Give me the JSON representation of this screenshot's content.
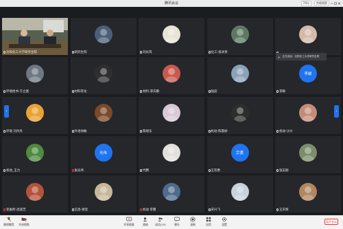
{
  "window": {
    "title": "腾讯会议",
    "count_badge": "29分",
    "view_button": "宫格视图"
  },
  "tiles": [
    {
      "label": "沈阳化工大学研究生院",
      "mic": "on",
      "kind": "video"
    },
    {
      "label": "研究生院",
      "mic": "on",
      "kind": "avatar",
      "avatar_color": "#4b5f78"
    },
    {
      "label": "刘长风",
      "mic": "on",
      "kind": "avatar",
      "avatar_color": "#e7e3d6"
    },
    {
      "label": "化工-张冰贵",
      "mic": "on",
      "kind": "avatar",
      "avatar_color": "#5c7a62"
    },
    {
      "label": "",
      "mic": "on",
      "kind": "avatar",
      "avatar_color": "#d3b9a8"
    },
    {
      "label": "环境给书-于立富",
      "mic": "on",
      "kind": "avatar",
      "avatar_color": "#6d7882"
    },
    {
      "label": "材料李龙",
      "mic": "on",
      "kind": "avatar",
      "avatar_color": "#2e2e2e"
    },
    {
      "label": "材料-李庆鹏",
      "mic": "on",
      "kind": "avatar",
      "avatar_color": "#c9594e"
    },
    {
      "label": "陆蕊",
      "mic": "on",
      "kind": "avatar",
      "avatar_color": "#8aa2b8"
    },
    {
      "label": "李颖",
      "mic": "on",
      "kind": "text",
      "avatar_text": "李颖"
    },
    {
      "label": "环境 刘丹丹",
      "mic": "on",
      "kind": "avatar",
      "avatar_color": "#e9a232"
    },
    {
      "label": "外语徐敏",
      "mic": "on",
      "kind": "avatar",
      "avatar_color": "#7a4a2a"
    },
    {
      "label": "陈晓东",
      "mic": "on",
      "kind": "avatar",
      "avatar_color": "#d8c8d8"
    },
    {
      "label": "机动-陈雷娇",
      "mic": "on",
      "kind": "avatar",
      "avatar_color": "#2d2d2d"
    },
    {
      "label": "机动-沙沙",
      "mic": "on",
      "kind": "avatar",
      "avatar_color": "#c48c78"
    },
    {
      "label": "机动_王力",
      "mic": "on",
      "kind": "avatar",
      "avatar_color": "#4f8a3e"
    },
    {
      "label": "张光伟",
      "mic": "off",
      "kind": "text",
      "avatar_text": "光伟"
    },
    {
      "label": "代腾",
      "mic": "on",
      "kind": "avatar",
      "avatar_color": "#e2e0dc"
    },
    {
      "label": "王宗勇",
      "mic": "on",
      "kind": "text",
      "avatar_text": "宗勇"
    },
    {
      "label": "张志刚",
      "mic": "on",
      "kind": "avatar",
      "avatar_color": "#7b8d6a"
    },
    {
      "label": "装备所-高淑芝",
      "mic": "off",
      "kind": "avatar",
      "avatar_color": "#b4523c"
    },
    {
      "label": "信息-谢莹",
      "mic": "on",
      "kind": "avatar",
      "avatar_color": "#c9b79a"
    },
    {
      "label": "机动 李震",
      "mic": "off",
      "kind": "avatar",
      "avatar_color": "#4e6b8c"
    },
    {
      "label": "宋兴飞",
      "mic": "on",
      "kind": "avatar",
      "avatar_color": "#c9d1d9"
    },
    {
      "label": "王庆辉",
      "mic": "on",
      "kind": "avatar",
      "avatar_color": "#b08660"
    }
  ],
  "notification": {
    "text": "正在讲话：沈阳化工大学研究生院"
  },
  "toolbar": {
    "mute_label": "解除静音",
    "video_label": "开启视频",
    "security_label": "共享屏幕",
    "invite_label": "邀请",
    "members_label": "成员(25)",
    "chat_label": "聊天",
    "record_label": "录制",
    "apps_label": "应用",
    "settings_label": "设置",
    "end_label": "离开会议"
  }
}
